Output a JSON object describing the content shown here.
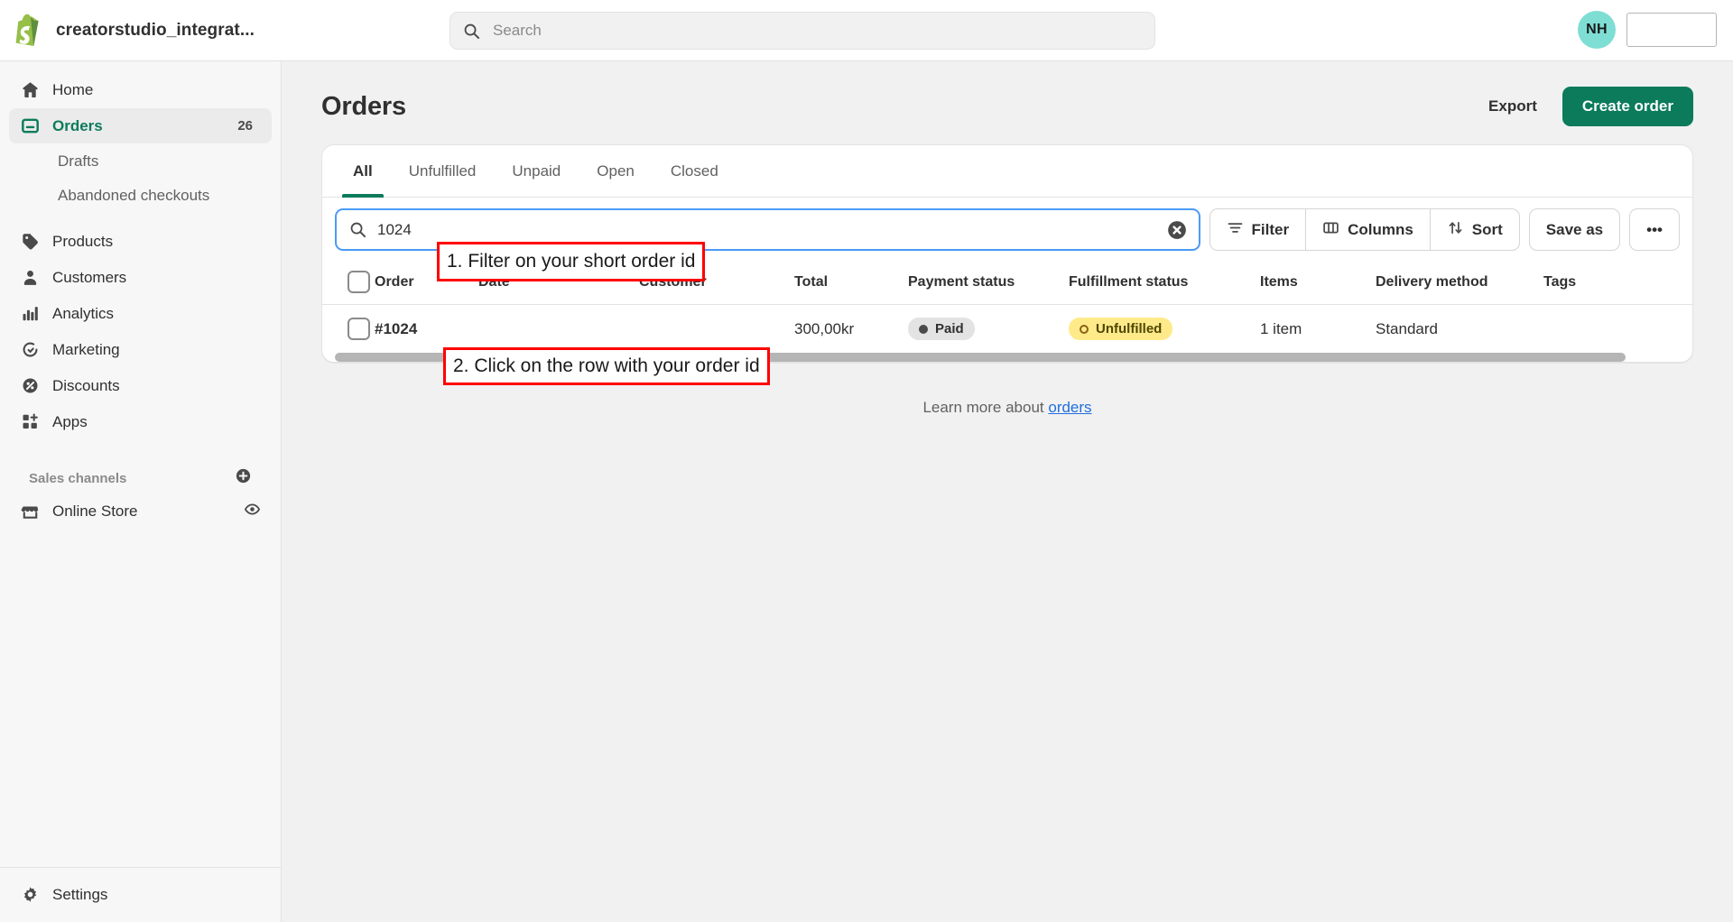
{
  "topbar": {
    "logo_icon": "shopify-bag-icon",
    "store_name": "creatorstudio_integrat...",
    "search": {
      "icon": "search-icon",
      "placeholder": "Search",
      "value": ""
    },
    "avatar_initials": "NH"
  },
  "sidebar": {
    "items": [
      {
        "label": "Home",
        "icon": "home-icon",
        "active": false,
        "badge": ""
      },
      {
        "label": "Orders",
        "icon": "orders-icon",
        "active": true,
        "badge": "26"
      },
      {
        "label": "Products",
        "icon": "products-tag-icon",
        "active": false,
        "badge": ""
      },
      {
        "label": "Customers",
        "icon": "customers-person-icon",
        "active": false,
        "badge": ""
      },
      {
        "label": "Analytics",
        "icon": "analytics-bars-icon",
        "active": false,
        "badge": ""
      },
      {
        "label": "Marketing",
        "icon": "marketing-target-icon",
        "active": false,
        "badge": ""
      },
      {
        "label": "Discounts",
        "icon": "discounts-percent-icon",
        "active": false,
        "badge": ""
      },
      {
        "label": "Apps",
        "icon": "apps-grid-icon",
        "active": false,
        "badge": ""
      }
    ],
    "sub_items": [
      {
        "label": "Drafts"
      },
      {
        "label": "Abandoned checkouts"
      }
    ],
    "sales_channels": {
      "title": "Sales channels",
      "add_icon": "plus-circle-icon",
      "items": [
        {
          "label": "Online Store",
          "icon": "online-store-icon",
          "trailing_icon": "eye-icon"
        }
      ]
    },
    "settings": {
      "label": "Settings",
      "icon": "gear-icon"
    }
  },
  "page": {
    "title": "Orders",
    "export_label": "Export",
    "create_order_label": "Create order",
    "accent_green": "#0b7b5b"
  },
  "tabs": [
    {
      "label": "All",
      "active": true
    },
    {
      "label": "Unfulfilled",
      "active": false
    },
    {
      "label": "Unpaid",
      "active": false
    },
    {
      "label": "Open",
      "active": false
    },
    {
      "label": "Closed",
      "active": false
    }
  ],
  "filterbar": {
    "search_icon": "search-icon",
    "search_value": "1024",
    "clear_icon": "clear-circle-icon",
    "filter_label": "Filter",
    "filter_icon": "filter-lines-icon",
    "columns_label": "Columns",
    "columns_icon": "columns-icon",
    "sort_label": "Sort",
    "sort_icon": "sort-arrows-icon",
    "save_as_label": "Save as",
    "more_label": "•••",
    "focus_border_color": "#4a9bf5"
  },
  "table": {
    "headers": [
      "Order",
      "Date",
      "Customer",
      "Total",
      "Payment status",
      "Fulfillment status",
      "Items",
      "Delivery method",
      "Tags"
    ],
    "rows": [
      {
        "order": "#1024",
        "date": "",
        "customer": "",
        "total": "300,00kr",
        "payment_status": "Paid",
        "fulfillment_status": "Unfulfilled",
        "items": "1 item",
        "delivery_method": "Standard",
        "tags": ""
      }
    ]
  },
  "footer": {
    "learn_more_prefix": "Learn more about ",
    "learn_more_link": "orders"
  },
  "annotations": [
    {
      "id": 1,
      "text": "1. Filter on your short order id",
      "color": "#ff0000"
    },
    {
      "id": 2,
      "text": "2. Click on the row with your order id",
      "color": "#ff0000"
    }
  ]
}
